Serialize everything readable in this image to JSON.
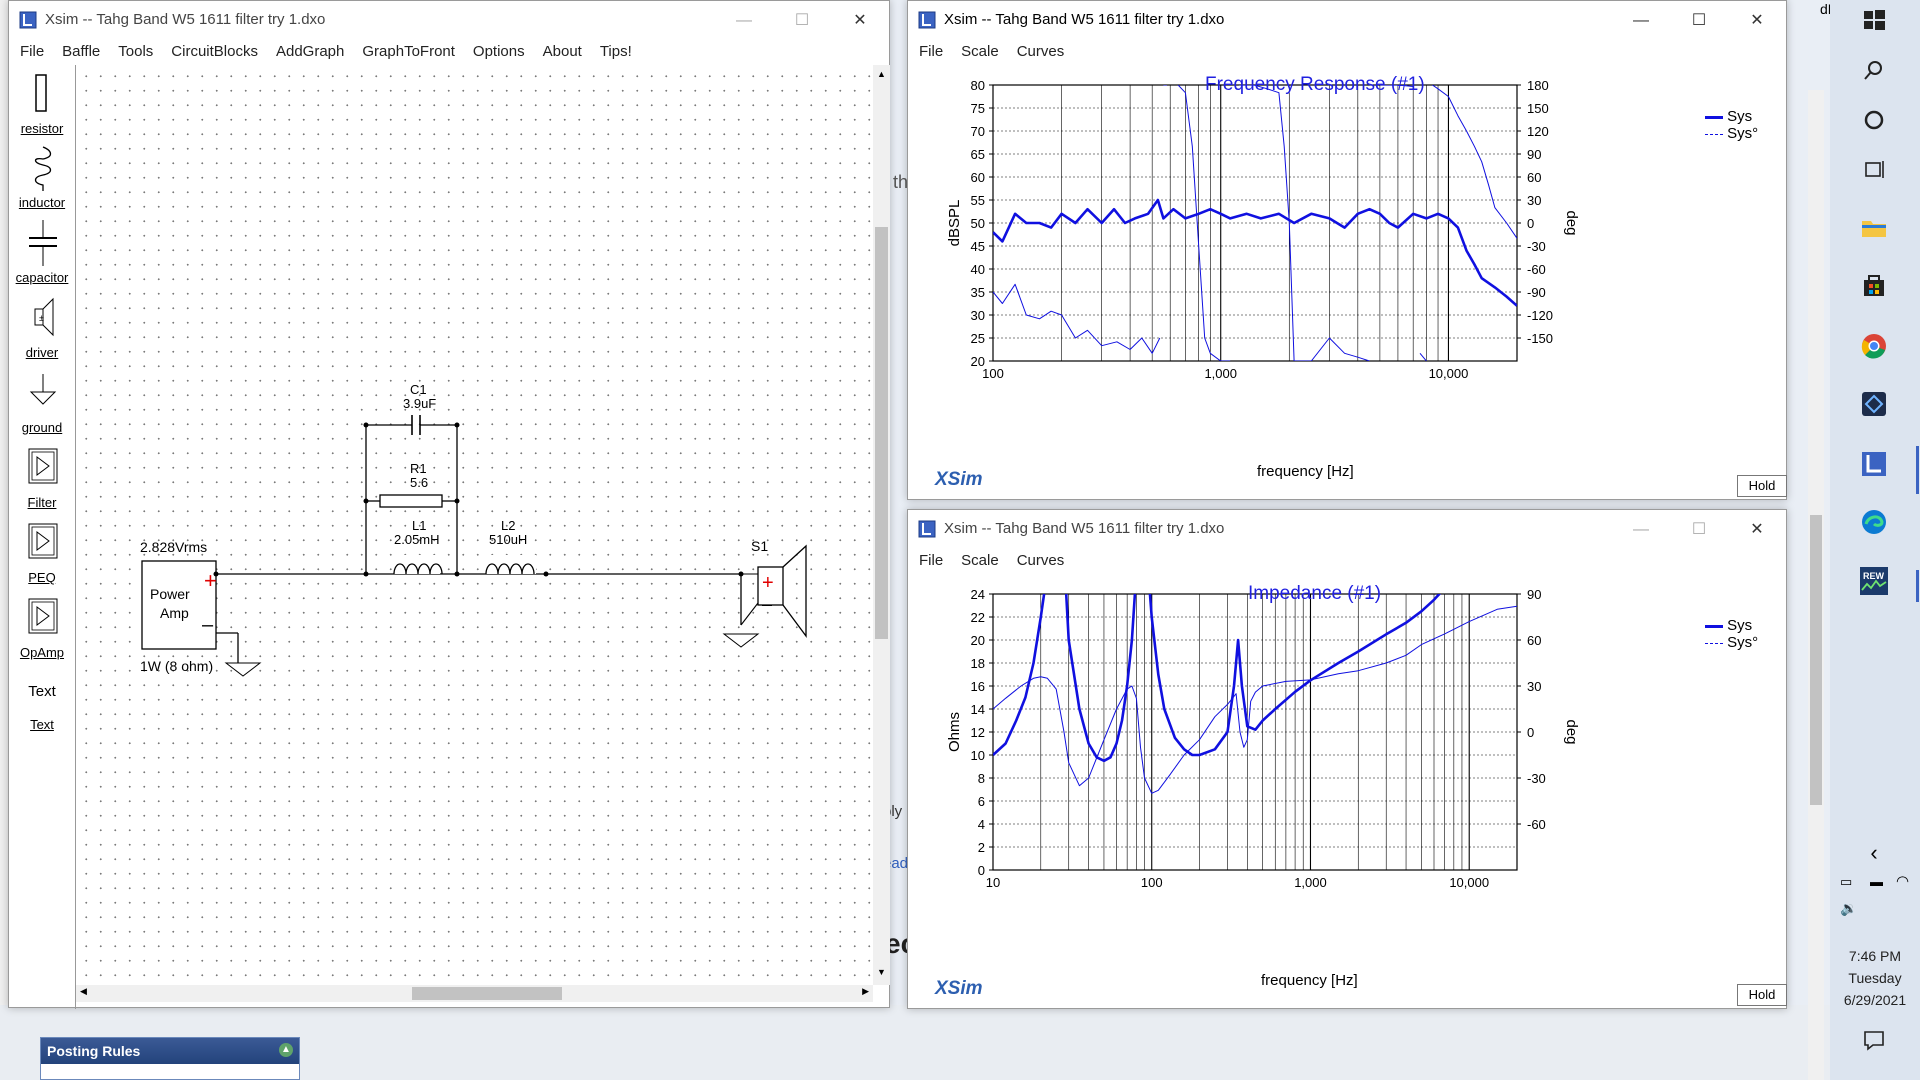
{
  "colors": {
    "blue": "#1010e0",
    "sysDashed": "#2020d0",
    "grid": "#000000",
    "bg": "#ffffff"
  },
  "schematic": {
    "title": "Xsim -- Tahg Band W5 1611 filter try 1.dxo",
    "menu": [
      "File",
      "Baffle",
      "Tools",
      "CircuitBlocks",
      "AddGraph",
      "GraphToFront",
      "Options",
      "About",
      "Tips!"
    ],
    "tools": [
      {
        "name": "resistor",
        "icon": "resistor-icon"
      },
      {
        "name": "inductor",
        "icon": "inductor-icon"
      },
      {
        "name": "capacitor",
        "icon": "capacitor-icon"
      },
      {
        "name": "driver",
        "icon": "driver-icon"
      },
      {
        "name": "ground",
        "icon": "ground-icon"
      },
      {
        "name": "Filter",
        "icon": "filter-icon"
      },
      {
        "name": "PEQ",
        "icon": "peq-icon"
      },
      {
        "name": "OpAmp",
        "icon": "opamp-icon"
      },
      {
        "name": "Text",
        "icon": "text-icon"
      }
    ],
    "text_tool_icon": "Text",
    "components": {
      "c1_name": "C1",
      "c1_value": "3.9uF",
      "r1_name": "R1",
      "r1_value": "5.6",
      "l1_name": "L1",
      "l1_value": "2.05mH",
      "l2_name": "L2",
      "l2_value": "510uH",
      "s1_name": "S1",
      "amp_voltage": "2.828Vrms",
      "amp_label_line1": "Power",
      "amp_label_line2": "Amp",
      "amp_power": "1W (8 ohm)"
    }
  },
  "freq": {
    "window_title": "Xsim -- Tahg Band W5 1611 filter try 1.dxo",
    "menu": [
      "File",
      "Scale",
      "Curves"
    ],
    "plot_title": "Frequency Response (#1)",
    "ylabel": "dBSPL",
    "y2label": "deg",
    "xlabel": "frequency [Hz]",
    "yticks": [
      "80",
      "75",
      "70",
      "65",
      "60",
      "55",
      "50",
      "45",
      "40",
      "35",
      "30",
      "25",
      "20"
    ],
    "y2ticks": [
      "180",
      "150",
      "120",
      "90",
      "60",
      "30",
      "0",
      "-30",
      "-60",
      "-90",
      "-120",
      "-150"
    ],
    "xticks": [
      "100",
      "1,000",
      "10,000"
    ],
    "legend": [
      "Sys",
      "Sys°"
    ],
    "brand": "XSim",
    "hold": "Hold"
  },
  "imp": {
    "window_title": "Xsim -- Tahg Band W5 1611 filter try 1.dxo",
    "menu": [
      "File",
      "Scale",
      "Curves"
    ],
    "plot_title": "Impedance (#1)",
    "ylabel": "Ohms",
    "y2label": "deg",
    "xlabel": "frequency [Hz]",
    "yticks": [
      "24",
      "22",
      "20",
      "18",
      "16",
      "14",
      "12",
      "10",
      "8",
      "6",
      "4",
      "2",
      "0"
    ],
    "y2ticks": [
      "90",
      "60",
      "30",
      "0",
      "-30",
      "-60"
    ],
    "xticks": [
      "10",
      "100",
      "1,000",
      "10,000"
    ],
    "legend": [
      "Sys",
      "Sys°"
    ],
    "brand": "XSim",
    "hold": "Hold"
  },
  "chart_data": [
    {
      "type": "line",
      "title": "Frequency Response (#1)",
      "xlabel": "frequency [Hz]",
      "ylabel": "dBSPL",
      "y2label": "deg",
      "xscale": "log",
      "xlim": [
        100,
        20000
      ],
      "ylim": [
        20,
        80
      ],
      "y2lim": [
        -180,
        180
      ],
      "grid": true,
      "legend": "top-right",
      "series": [
        {
          "name": "Sys",
          "axis": "left",
          "x": [
            100,
            110,
            125,
            140,
            160,
            180,
            200,
            230,
            260,
            300,
            340,
            380,
            420,
            480,
            530,
            560,
            620,
            700,
            800,
            900,
            1000,
            1100,
            1300,
            1500,
            1800,
            2100,
            2500,
            3000,
            3500,
            4000,
            4500,
            5000,
            5500,
            6000,
            7000,
            8000,
            9000,
            10000,
            11000,
            12000,
            13000,
            14000,
            16000,
            18000,
            20000
          ],
          "values": [
            48,
            46,
            52,
            50,
            50,
            49,
            52,
            50,
            53,
            50,
            53,
            50,
            51,
            52,
            55,
            51,
            53,
            51,
            52,
            53,
            52,
            51,
            52,
            51,
            52,
            50,
            52,
            51,
            49,
            52,
            53,
            52,
            50,
            49,
            52,
            51,
            52,
            51,
            49,
            44,
            41,
            38,
            36,
            34,
            32
          ]
        },
        {
          "name": "Sys°",
          "axis": "right",
          "x": [
            100,
            110,
            125,
            140,
            160,
            180,
            200,
            230,
            260,
            300,
            350,
            400,
            450,
            500,
            540,
            560,
            580,
            600,
            650,
            700,
            750,
            800,
            850,
            900,
            1000,
            1100,
            1200,
            1400,
            1600,
            1800,
            1900,
            2000,
            2100,
            2500,
            3000,
            3500,
            4000,
            4500,
            5000,
            5500,
            6000,
            7000,
            7500,
            8000,
            8500,
            9000,
            10000,
            11000,
            12000,
            13000,
            14000,
            15000,
            16000,
            18000,
            20000
          ],
          "values": [
            -90,
            -105,
            -80,
            -120,
            -125,
            -115,
            -120,
            -150,
            -140,
            -160,
            -155,
            -165,
            -150,
            -170,
            -150,
            180,
            180,
            -180,
            180,
            170,
            100,
            -30,
            -150,
            -170,
            -180,
            -180,
            180,
            180,
            175,
            170,
            100,
            0,
            -180,
            -180,
            -150,
            -170,
            -175,
            -180,
            180,
            180,
            180,
            178,
            -170,
            -180,
            180,
            175,
            165,
            140,
            120,
            100,
            80,
            50,
            20,
            0,
            -20
          ]
        }
      ]
    },
    {
      "type": "line",
      "title": "Impedance (#1)",
      "xlabel": "frequency [Hz]",
      "ylabel": "Ohms",
      "y2label": "deg",
      "xscale": "log",
      "xlim": [
        10,
        20000
      ],
      "ylim": [
        0,
        24
      ],
      "y2lim": [
        -90,
        90
      ],
      "grid": true,
      "legend": "top-right",
      "series": [
        {
          "name": "Sys",
          "axis": "left",
          "x": [
            10,
            12,
            14,
            16,
            18,
            20,
            22,
            25,
            30,
            35,
            40,
            45,
            50,
            55,
            60,
            65,
            70,
            75,
            80,
            85,
            90,
            95,
            100,
            110,
            120,
            140,
            160,
            180,
            200,
            250,
            300,
            330,
            350,
            370,
            400,
            450,
            500,
            600,
            800,
            1000,
            1500,
            2000,
            3000,
            4000,
            5000,
            6000,
            7000,
            8000
          ],
          "values": [
            10,
            11,
            13,
            15,
            18,
            22,
            26,
            40,
            20,
            14,
            11,
            9.8,
            9.5,
            9.8,
            11,
            13,
            16,
            20,
            26,
            40,
            30,
            26,
            22,
            17,
            14,
            11.5,
            10.5,
            10,
            10,
            10.5,
            12,
            16,
            20,
            16,
            12.5,
            12.2,
            13,
            14,
            15.5,
            16.5,
            18,
            19,
            20.5,
            21.5,
            22.5,
            23.5,
            24.5,
            26
          ]
        },
        {
          "name": "Sys°",
          "axis": "right",
          "x": [
            10,
            12,
            15,
            18,
            20,
            22,
            25,
            28,
            30,
            35,
            40,
            50,
            60,
            70,
            75,
            80,
            85,
            90,
            100,
            110,
            130,
            160,
            200,
            250,
            300,
            340,
            360,
            380,
            400,
            420,
            450,
            500,
            700,
            1000,
            1500,
            2000,
            3000,
            4000,
            5000,
            7000,
            10000,
            15000,
            20000
          ],
          "values": [
            15,
            22,
            30,
            35,
            36,
            35,
            28,
            0,
            -20,
            -35,
            -30,
            -5,
            15,
            28,
            30,
            22,
            -10,
            -30,
            -40,
            -38,
            -28,
            -15,
            -5,
            10,
            18,
            25,
            0,
            -10,
            -5,
            20,
            26,
            30,
            33,
            34,
            38,
            40,
            45,
            50,
            57,
            64,
            72,
            80,
            82
          ]
        }
      ]
    }
  ],
  "tray": {
    "time": "7:46 PM",
    "day": "Tuesday",
    "date": "6/29/2021"
  },
  "background": {
    "posting_rules": "Posting Rules",
    "snippet1": "th",
    "snippet2": "ply",
    "snippet3": "ead",
    "snippet4": "ec"
  }
}
